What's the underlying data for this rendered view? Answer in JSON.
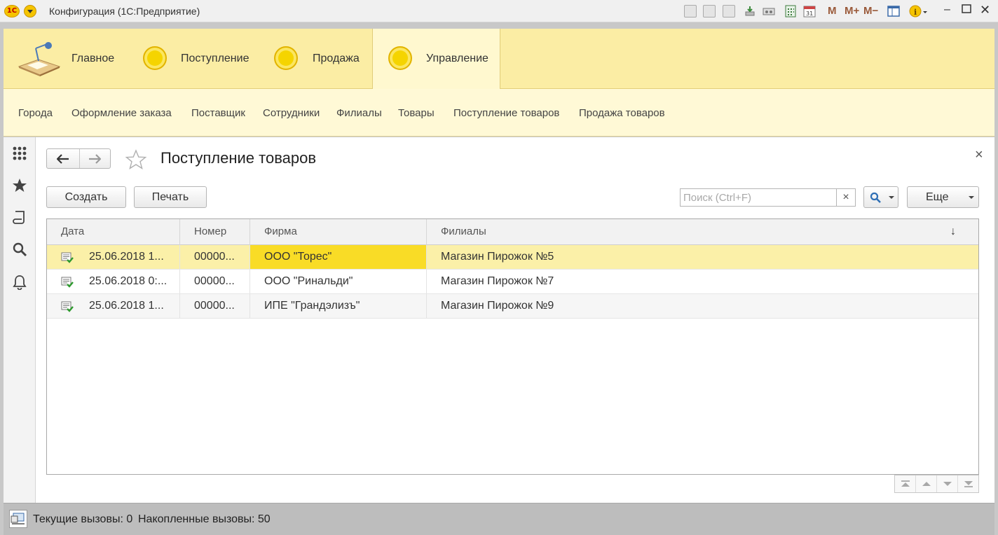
{
  "window": {
    "title": "Конфигурация (1С:Предприятие)",
    "logo_text": "1С",
    "toolbar_m_labels": [
      "M",
      "M+",
      "M−"
    ]
  },
  "sections": [
    {
      "label": "Главное",
      "icon": "desk-lamp-icon"
    },
    {
      "label": "Поступление",
      "icon": "coin-icon"
    },
    {
      "label": "Продажа",
      "icon": "coin-icon"
    },
    {
      "label": "Управление",
      "icon": "coin-icon",
      "active": true
    }
  ],
  "commands": [
    "Города",
    "Оформление заказа",
    "Поставщик",
    "Сотрудники",
    "Филиалы",
    "Товары",
    "Поступление товаров",
    "Продажа товаров"
  ],
  "form": {
    "title": "Поступление товаров",
    "create_label": "Создать",
    "print_label": "Печать",
    "search_placeholder": "Поиск (Ctrl+F)",
    "more_label": "Еще",
    "close_glyph": "×"
  },
  "table": {
    "columns": [
      "Дата",
      "Номер",
      "Фирма",
      "Филиалы"
    ],
    "sort_glyph": "↓",
    "rows": [
      {
        "date": "25.06.2018 1...",
        "number": "00000...",
        "firm": "ООО \"Торес\"",
        "branch": "Магазин Пирожок №5",
        "selected": true
      },
      {
        "date": "25.06.2018 0:...",
        "number": "00000...",
        "firm": "ООО \"Ринальди\"",
        "branch": "Магазин Пирожок №7"
      },
      {
        "date": "25.06.2018 1...",
        "number": "00000...",
        "firm": "ИПЕ \"Грандэлизъ\"",
        "branch": "Магазин Пирожок №9"
      }
    ]
  },
  "status": {
    "current_calls": "Текущие вызовы: 0",
    "accumulated_calls": "Накопленные вызовы: 50"
  },
  "colors": {
    "section_bg": "#fbeda4",
    "commands_bg": "#fff9d6",
    "selected_row": "#fbf0a8",
    "active_cell": "#f9dc26"
  }
}
